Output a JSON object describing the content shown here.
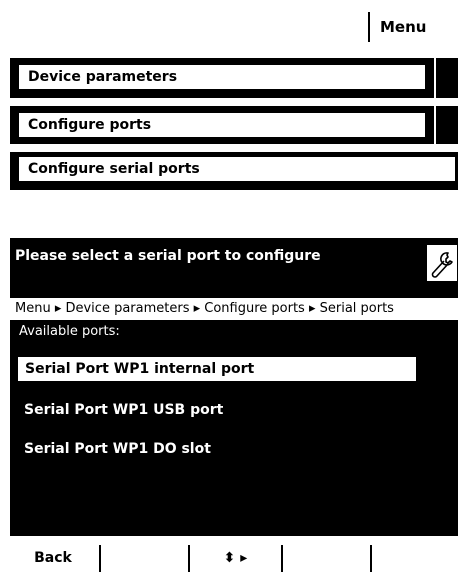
{
  "header": {
    "menu_label": "Menu"
  },
  "stack": {
    "items": [
      {
        "label": "Device parameters"
      },
      {
        "label": "Configure ports"
      },
      {
        "label": "Configure serial ports"
      }
    ]
  },
  "panel": {
    "title": "Please select a serial port to configure",
    "settings_icon": "wrench-icon",
    "breadcrumb": "Menu ▸ Device parameters ▸ Configure ports ▸ Serial ports",
    "available_label": "Available ports:",
    "ports": [
      {
        "label": "Serial Port WP1 internal port",
        "selected": true
      },
      {
        "label": "Serial Port WP1 USB port",
        "selected": false
      },
      {
        "label": "Serial Port WP1 DO slot",
        "selected": false
      }
    ]
  },
  "softkeys": {
    "back": "Back",
    "nav": "⬍ ▸"
  }
}
